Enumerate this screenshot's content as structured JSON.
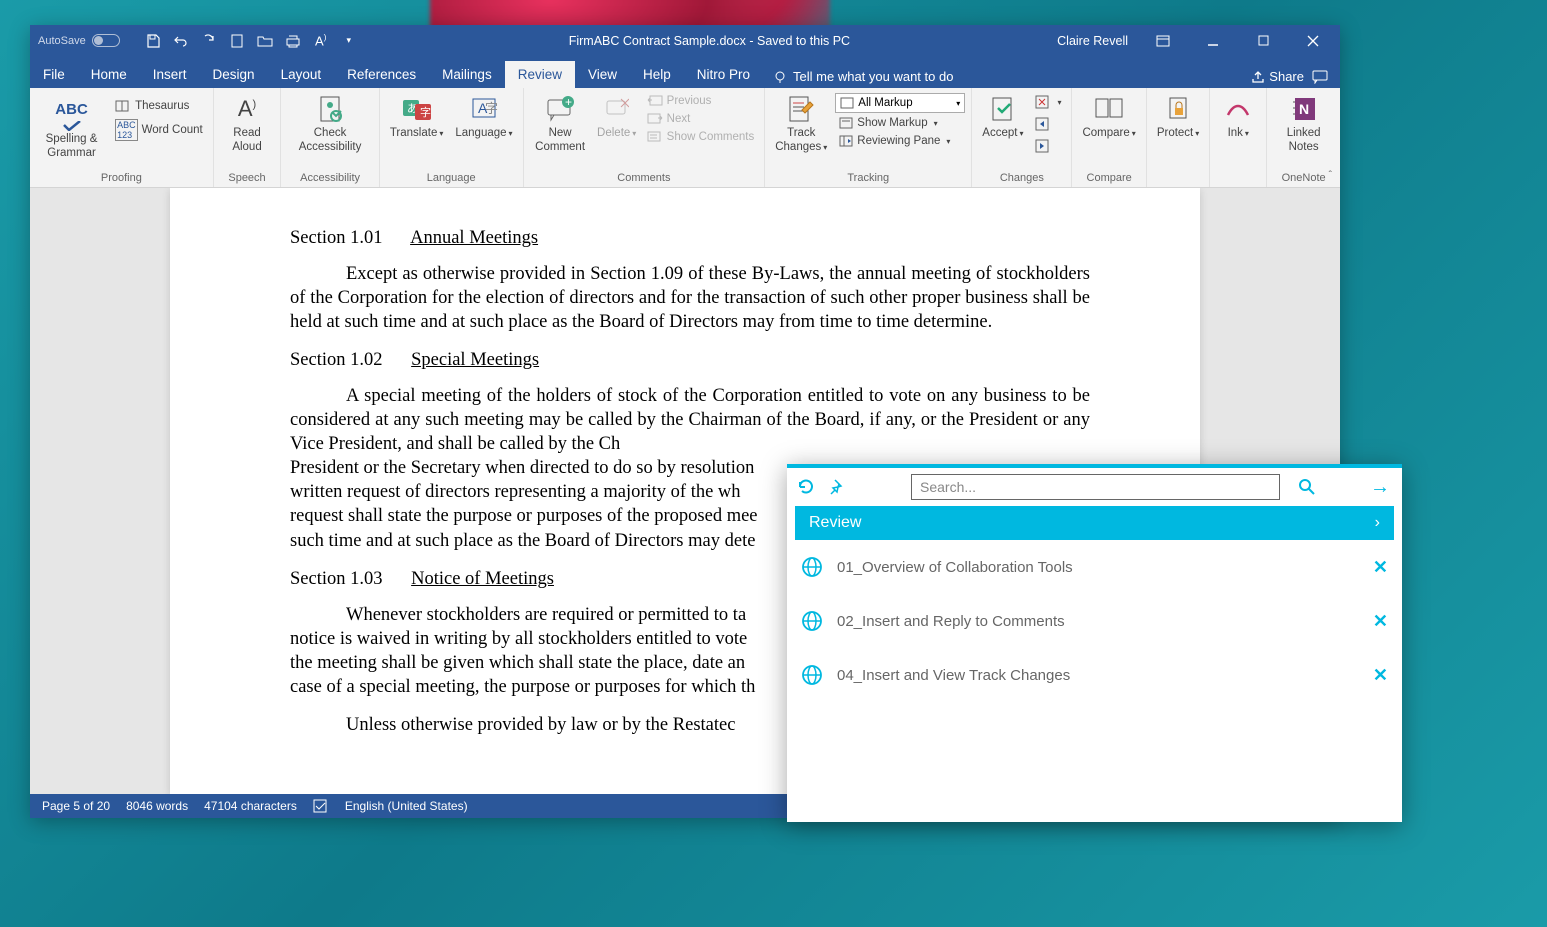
{
  "titleBar": {
    "autosave": "AutoSave",
    "docTitle": "FirmABC Contract Sample.docx  -  Saved to this PC",
    "user": "Claire Revell"
  },
  "tabs": [
    "File",
    "Home",
    "Insert",
    "Design",
    "Layout",
    "References",
    "Mailings",
    "Review",
    "View",
    "Help",
    "Nitro Pro"
  ],
  "activeTab": "Review",
  "tellMe": "Tell me what you want to do",
  "share": "Share",
  "ribbon": {
    "proofing": {
      "spellGrammar": "Spelling & Grammar",
      "thesaurus": "Thesaurus",
      "wordCount": "Word Count",
      "label": "Proofing"
    },
    "speech": {
      "readAloud": "Read Aloud",
      "label": "Speech"
    },
    "access": {
      "check": "Check Accessibility",
      "label": "Accessibility"
    },
    "language": {
      "translate": "Translate",
      "language": "Language",
      "label": "Language"
    },
    "comments": {
      "new": "New Comment",
      "delete": "Delete",
      "previous": "Previous",
      "next": "Next",
      "show": "Show Comments",
      "label": "Comments"
    },
    "tracking": {
      "trackChanges": "Track Changes",
      "markup": "All Markup",
      "showMarkup": "Show Markup",
      "reviewingPane": "Reviewing Pane",
      "label": "Tracking"
    },
    "changes": {
      "accept": "Accept",
      "label": "Changes"
    },
    "compare": {
      "compare": "Compare",
      "label": "Compare"
    },
    "protect": {
      "protect": "Protect"
    },
    "ink": {
      "ink": "Ink"
    },
    "onenote": {
      "linked": "Linked Notes",
      "label": "OneNote"
    }
  },
  "document": {
    "s1": {
      "num": "Section 1.01",
      "title": "Annual Meetings"
    },
    "p1": "Except as otherwise provided in Section 1.09 of these By-Laws, the annual meeting of stockholders of the Corporation for the election of directors and for the transaction of such other proper business shall be held at such time and at such place as the Board of Directors may from time to time determine.",
    "s2": {
      "num": "Section 1.02",
      "title": "Special Meetings"
    },
    "p2": "A special meeting of the holders of stock of the Corporation entitled to vote on any business to be considered at any such meeting may be called by the Chairman of the Board, if any, or the President or any Vice President, and shall be called by the Ch",
    "p2b": "President or the Secretary when directed to do so by resolution",
    "p2c": "written request of directors representing a majority of the wh",
    "p2d": "request shall state the purpose or purposes of the proposed mee",
    "p2e": "such time and at such place as the Board of Directors may dete",
    "s3": {
      "num": "Section 1.03",
      "title": "Notice of Meetings"
    },
    "p3": "Whenever stockholders are required or permitted to ta",
    "p3b": "notice is waived in writing by all stockholders entitled to vote",
    "p3c": "the meeting shall be given which shall state the place, date an",
    "p3d": "case of a special meeting, the purpose or purposes for which th",
    "p4": "Unless otherwise provided by law or by the Restatec"
  },
  "statusBar": {
    "page": "Page 5 of 20",
    "words": "8046 words",
    "chars": "47104 characters",
    "lang": "English (United States)"
  },
  "overlay": {
    "searchPlaceholder": "Search...",
    "header": "Review",
    "items": [
      "01_Overview of Collaboration Tools",
      "02_Insert and Reply to Comments",
      "04_Insert and View Track Changes"
    ]
  }
}
